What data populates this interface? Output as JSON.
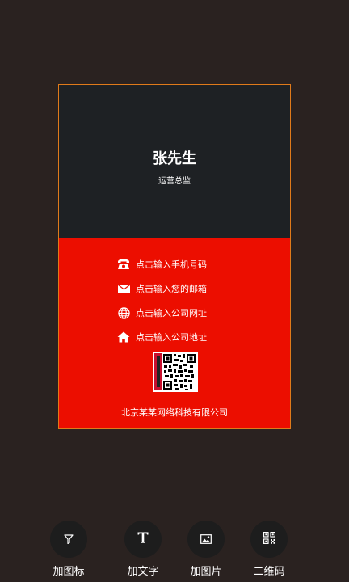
{
  "card": {
    "name": "张先生",
    "title": "运营总监",
    "contacts": [
      {
        "icon": "phone-icon",
        "text": "点击输入手机号码"
      },
      {
        "icon": "mail-icon",
        "text": "点击输入您的邮箱"
      },
      {
        "icon": "globe-icon",
        "text": "点击输入公司网址"
      },
      {
        "icon": "home-icon",
        "text": "点击输入公司地址"
      }
    ],
    "company": "北京某某网络科技有限公司",
    "colors": {
      "top": "#1e2124",
      "bottom": "#ec0e00",
      "border": "#e07a1a"
    }
  },
  "toolbar": {
    "items": [
      {
        "icon": "filter-icon",
        "label": "加图标"
      },
      {
        "icon": "text-icon",
        "label": "加文字"
      },
      {
        "icon": "image-icon",
        "label": "加图片"
      },
      {
        "icon": "qr-code-icon",
        "label": "二维码"
      }
    ]
  },
  "colors": {
    "background": "#2a2220"
  }
}
